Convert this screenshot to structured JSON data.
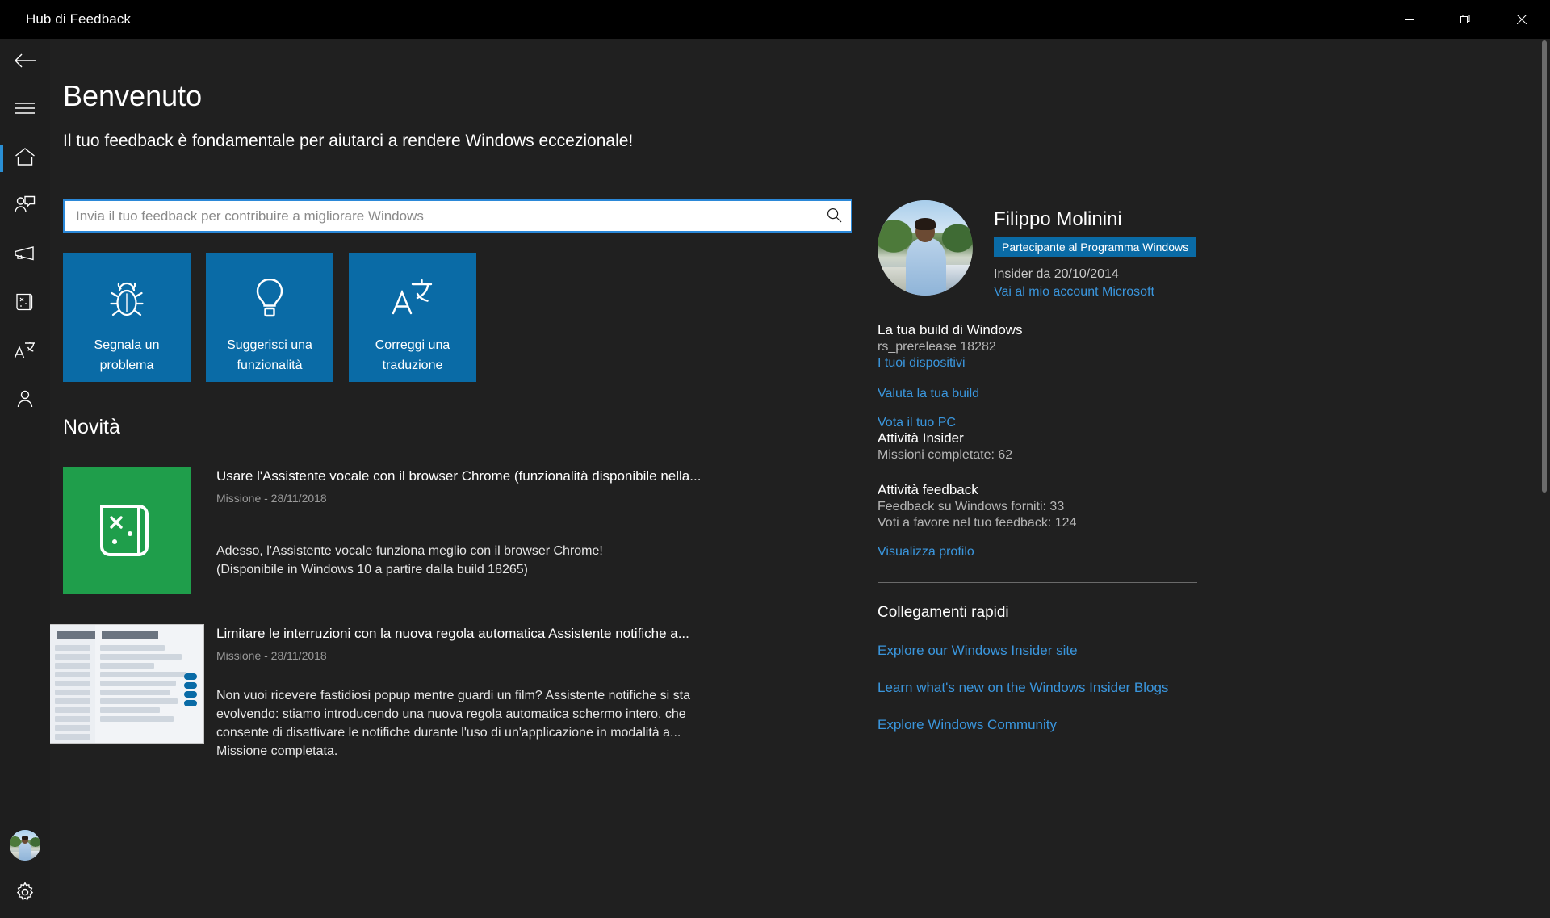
{
  "window": {
    "title": "Hub di Feedback",
    "minimize_label": "Riduci a icona",
    "restore_label": "Ripristina",
    "close_label": "Chiudi"
  },
  "rail": {
    "items": [
      {
        "name": "back",
        "label": "Indietro",
        "icon": "back-arrow-icon"
      },
      {
        "name": "menu",
        "label": "Menu",
        "icon": "hamburger-icon"
      },
      {
        "name": "home",
        "label": "Home",
        "icon": "home-icon",
        "selected": true
      },
      {
        "name": "feedback",
        "label": "Feedback",
        "icon": "person-chat-icon"
      },
      {
        "name": "announcements",
        "label": "Annunci",
        "icon": "megaphone-icon"
      },
      {
        "name": "quests",
        "label": "Missioni",
        "icon": "scroll-quest-icon"
      },
      {
        "name": "translate",
        "label": "Traduzioni",
        "icon": "translate-icon"
      },
      {
        "name": "account",
        "label": "Account",
        "icon": "person-icon"
      }
    ],
    "bottom": [
      {
        "name": "avatar",
        "label": "Filippo Molinini",
        "icon": "avatar-photo"
      },
      {
        "name": "settings",
        "label": "Impostazioni",
        "icon": "gear-icon"
      }
    ]
  },
  "main": {
    "title": "Benvenuto",
    "subtitle": "Il tuo feedback è fondamentale per aiutarci a rendere Windows eccezionale!",
    "search": {
      "value": "",
      "placeholder": "Invia il tuo feedback per contribuire a migliorare Windows",
      "icon": "search-icon"
    },
    "tiles": [
      {
        "label": "Segnala un problema",
        "icon": "bug-icon"
      },
      {
        "label": "Suggerisci una funzionalità",
        "icon": "lightbulb-icon"
      },
      {
        "label": "Correggi una traduzione",
        "icon": "translate-icon"
      }
    ],
    "news_heading": "Novità",
    "news": [
      {
        "title": "Usare l'Assistente vocale con il browser Chrome (funzionalità disponibile nella...",
        "meta": "Missione  -  28/11/2018",
        "body": "Adesso, l'Assistente vocale funziona meglio con il browser Chrome!\n(Disponibile in Windows 10 a partire dalla build 18265)",
        "thumb": "quest-scroll-thumbnail"
      },
      {
        "title": "Limitare le interruzioni con la nuova regola automatica Assistente notifiche a...",
        "meta": "Missione  -  28/11/2018",
        "body": "Non vuoi ricevere fastidiosi popup mentre guardi un film? Assistente notifiche si sta evolvendo: stiamo introducendo una nuova regola automatica schermo intero, che consente di disattivare le notifiche durante l'uso di un'applicazione in modalità a... Missione completata.",
        "thumb": "settings-screenshot-thumbnail"
      }
    ]
  },
  "right_panel": {
    "profile": {
      "name": "Filippo Molinini",
      "badge": "Partecipante al Programma Windows",
      "insider_since": "Insider da 20/10/2014",
      "account_link": "Vai al mio account Microsoft",
      "avatar": "avatar-photo"
    },
    "build": {
      "heading": "La tua build di Windows",
      "value": "rs_prerelease 18282",
      "devices_link": "I tuoi dispositivi",
      "rate_link": "Valuta la tua build",
      "vote_link": "Vota il tuo PC"
    },
    "insider_activity": {
      "heading": "Attività Insider",
      "quests": "Missioni completate: 62"
    },
    "feedback_activity": {
      "heading": "Attività feedback",
      "given": "Feedback su Windows forniti: 33",
      "upvotes": "Voti a favore nel tuo feedback: 124",
      "profile_link": "Visualizza profilo"
    },
    "quick_links": {
      "title": "Collegamenti rapidi",
      "links": [
        "Explore our Windows Insider site",
        "Learn what's new on the Windows Insider Blogs",
        "Explore Windows Community"
      ]
    }
  },
  "colors": {
    "accent": "#0a6ba6",
    "link": "#3a96dd",
    "focus_border": "#2b88d8",
    "quest_green": "#1f9e4b",
    "titlebar": "#000000",
    "page_bg": "#202020",
    "rail_bg": "#1e1e1e"
  }
}
